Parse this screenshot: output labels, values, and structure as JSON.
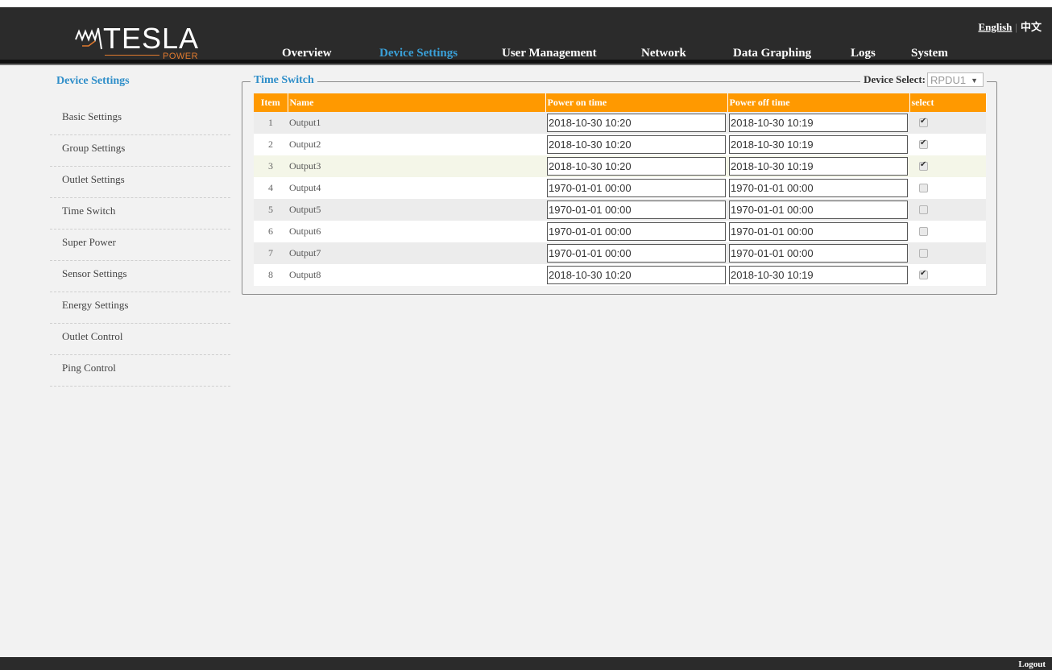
{
  "header": {
    "logo_text": "TESLA",
    "logo_sub": "POWER",
    "lang_en": "English",
    "lang_sep": "|",
    "lang_zh": "中文",
    "nav": [
      {
        "label": "Overview"
      },
      {
        "label": "Device Settings",
        "active": true
      },
      {
        "label": "User Management"
      },
      {
        "label": "Network"
      },
      {
        "label": "Data Graphing"
      },
      {
        "label": "Logs"
      },
      {
        "label": "System"
      }
    ]
  },
  "sidebar": {
    "title": "Device Settings",
    "items": [
      {
        "label": "Basic Settings"
      },
      {
        "label": "Group Settings"
      },
      {
        "label": "Outlet Settings"
      },
      {
        "label": "Time Switch"
      },
      {
        "label": "Super Power"
      },
      {
        "label": "Sensor Settings"
      },
      {
        "label": "Energy Settings"
      },
      {
        "label": "Outlet Control"
      },
      {
        "label": "Ping Control"
      }
    ]
  },
  "panel": {
    "title": "Time Switch",
    "device_select_label": "Device Select:",
    "device_select_value": "RPDU1"
  },
  "table": {
    "headers": [
      "Item",
      "Name",
      "Power on time",
      "Power off time",
      "select"
    ],
    "rows": [
      {
        "item": "1",
        "name": "Output1",
        "on": "2018-10-30 10:20",
        "off": "2018-10-30 10:19",
        "checked": true
      },
      {
        "item": "2",
        "name": "Output2",
        "on": "2018-10-30 10:20",
        "off": "2018-10-30 10:19",
        "checked": true
      },
      {
        "item": "3",
        "name": "Output3",
        "on": "2018-10-30 10:20",
        "off": "2018-10-30 10:19",
        "checked": true
      },
      {
        "item": "4",
        "name": "Output4",
        "on": "1970-01-01 00:00",
        "off": "1970-01-01 00:00",
        "checked": false
      },
      {
        "item": "5",
        "name": "Output5",
        "on": "1970-01-01 00:00",
        "off": "1970-01-01 00:00",
        "checked": false
      },
      {
        "item": "6",
        "name": "Output6",
        "on": "1970-01-01 00:00",
        "off": "1970-01-01 00:00",
        "checked": false
      },
      {
        "item": "7",
        "name": "Output7",
        "on": "1970-01-01 00:00",
        "off": "1970-01-01 00:00",
        "checked": false
      },
      {
        "item": "8",
        "name": "Output8",
        "on": "2018-10-30 10:20",
        "off": "2018-10-30 10:19",
        "checked": true
      }
    ]
  },
  "footer": {
    "logout": "Logout"
  },
  "colors": {
    "accent": "#2e8ec9",
    "table_header": "#ff9900",
    "header_bg": "#2b2b2b",
    "logo_orange": "#e07a2e"
  }
}
